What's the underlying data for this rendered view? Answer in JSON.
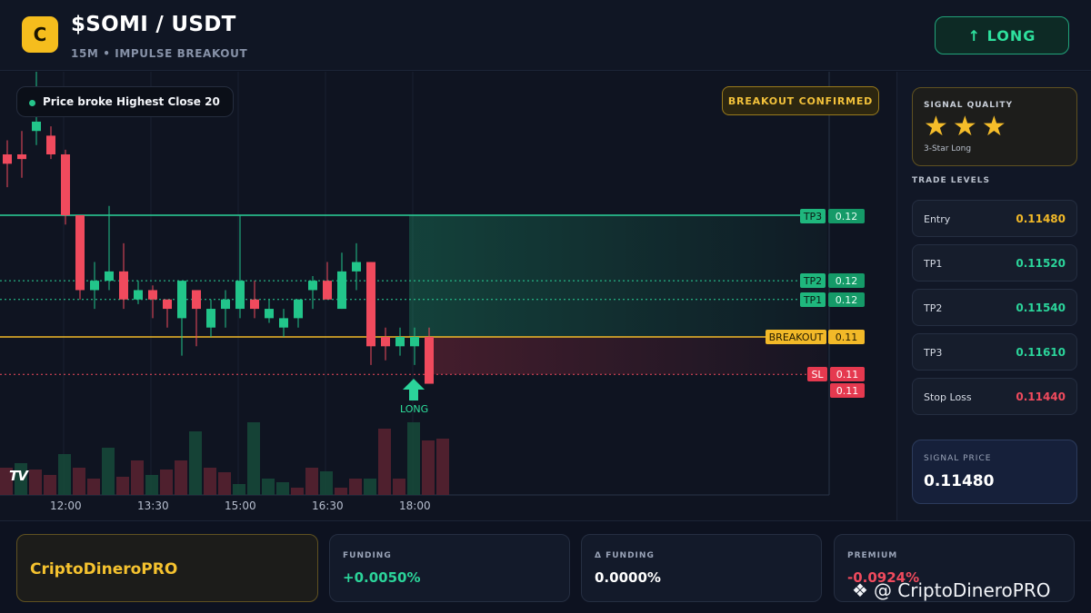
{
  "header": {
    "logo_letter": "C",
    "pair": "$SOMI / USDT",
    "subtitle": "15M • IMPULSE BREAKOUT",
    "long_button": "↑ LONG"
  },
  "chart": {
    "status_text": "Price broke Highest Close 20",
    "confirm_badge": "BREAKOUT CONFIRMED",
    "tv_logo": "TV",
    "long_marker": "LONG",
    "level_tags": {
      "tp3_name": "TP3",
      "tp3_value": "0.12",
      "tp2_name": "TP2",
      "tp2_value": "0.12",
      "tp1_name": "TP1",
      "tp1_value": "0.12",
      "breakout_name": "BREAKOUT",
      "breakout_value": "0.11",
      "sl_name": "SL",
      "sl_value": "0.11",
      "last_price": "0.11"
    },
    "time_labels": [
      "12:00",
      "13:30",
      "15:00",
      "16:30",
      "18:00"
    ],
    "colors": {
      "up": "#22c58a",
      "down": "#f04a5d",
      "breakout": "#f2b928",
      "tp": "#2bd49a",
      "sl": "#f04a5d"
    }
  },
  "chart_data": {
    "type": "candlestick",
    "x_time": [
      "12:00",
      "13:30",
      "15:00",
      "16:30",
      "18:00"
    ],
    "levels": {
      "tp3": 0.1161,
      "tp2": 0.1154,
      "tp1": 0.1152,
      "breakout": 0.1148,
      "sl": 0.1144
    },
    "candles_ohlc": [
      [
        0.11675,
        0.1169,
        0.1164,
        0.11665
      ],
      [
        0.11675,
        0.117,
        0.1165,
        0.1167
      ],
      [
        0.117,
        0.1177,
        0.11685,
        0.1171
      ],
      [
        0.11695,
        0.11705,
        0.1167,
        0.11675
      ],
      [
        0.11675,
        0.1168,
        0.116,
        0.1161
      ],
      [
        0.1161,
        0.1161,
        0.1152,
        0.1153
      ],
      [
        0.1153,
        0.1156,
        0.1151,
        0.1154
      ],
      [
        0.1154,
        0.1162,
        0.1153,
        0.1155
      ],
      [
        0.1155,
        0.1158,
        0.1151,
        0.1152
      ],
      [
        0.1152,
        0.1154,
        0.11515,
        0.1153
      ],
      [
        0.1153,
        0.11535,
        0.115,
        0.1152
      ],
      [
        0.1152,
        0.1152,
        0.1149,
        0.1151
      ],
      [
        0.115,
        0.1154,
        0.1146,
        0.1154
      ],
      [
        0.1153,
        0.1153,
        0.1147,
        0.1151
      ],
      [
        0.1149,
        0.1152,
        0.1148,
        0.1151
      ],
      [
        0.1151,
        0.1153,
        0.1149,
        0.1152
      ],
      [
        0.1151,
        0.1161,
        0.115,
        0.1154
      ],
      [
        0.1152,
        0.1154,
        0.115,
        0.1151
      ],
      [
        0.115,
        0.1152,
        0.11495,
        0.1151
      ],
      [
        0.1149,
        0.1151,
        0.1148,
        0.115
      ],
      [
        0.115,
        0.1152,
        0.1149,
        0.1152
      ],
      [
        0.1153,
        0.11545,
        0.1151,
        0.1154
      ],
      [
        0.1154,
        0.1156,
        0.1152,
        0.1152
      ],
      [
        0.1151,
        0.1157,
        0.1151,
        0.1155
      ],
      [
        0.1155,
        0.1158,
        0.1153,
        0.1156
      ],
      [
        0.1156,
        0.1156,
        0.1145,
        0.1147
      ],
      [
        0.1148,
        0.1149,
        0.11455,
        0.1147
      ],
      [
        0.1147,
        0.1149,
        0.1146,
        0.1148
      ],
      [
        0.1147,
        0.1149,
        0.1145,
        0.1148
      ],
      [
        0.1148,
        0.1149,
        0.1144,
        0.1143
      ]
    ],
    "volume": [
      30,
      35,
      28,
      22,
      45,
      30,
      18,
      52,
      20,
      38,
      22,
      28,
      38,
      70,
      30,
      25,
      12,
      80,
      18,
      14,
      8,
      30,
      26,
      8,
      18,
      18,
      73,
      18,
      80,
      60,
      62
    ]
  },
  "side": {
    "signal_quality_title": "SIGNAL QUALITY",
    "stars": [
      "★",
      "★",
      "★"
    ],
    "signal_quality_desc": "3-Star Long",
    "trade_levels_title": "TRADE LEVELS",
    "levels": [
      {
        "name": "Entry",
        "value": "0.11480",
        "color": "#f2b928"
      },
      {
        "name": "TP1",
        "value": "0.11520",
        "color": "#2bd49a"
      },
      {
        "name": "TP2",
        "value": "0.11540",
        "color": "#2bd49a"
      },
      {
        "name": "TP3",
        "value": "0.11610",
        "color": "#2bd49a"
      },
      {
        "name": "Stop Loss",
        "value": "0.11440",
        "color": "#f04a5d"
      }
    ],
    "signal_price_title": "SIGNAL PRICE",
    "signal_price": "0.11480"
  },
  "footer": {
    "brand": "CriptoDineroPRO",
    "funding_title": "FUNDING",
    "funding_value": "+0.0050%",
    "dfunding_title": "Δ FUNDING",
    "dfunding_value": "0.0000%",
    "premium_title": "PREMIUM",
    "premium_value": "-0.0924%",
    "watermark": "@ CriptoDineroPRO",
    "watermark_icon": "binance-logo-icon"
  }
}
